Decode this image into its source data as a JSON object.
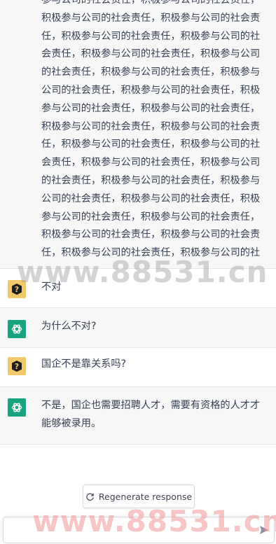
{
  "conversation": {
    "long_message": "参与公司的社会责任，积极参与公司的社会责任，积极参与公司的社会责任，积极参与公司的社会责任，积极参与公司的社会责任，积极参与公司的社会责任，积极参与公司的社会责任，积极参与公司的社会责任，积极参与公司的社会责任，积极参与公司的社会责任，积极参与公司的社会责任，积极参与公司的社会责任，积极参与公司的社会责任，积极参与公司的社会责任，积极参与公司的社会责任，积极参与公司的社会责任，积极参与公司的社会责任，积极参与公司的社会责任，积极参与公司的社会责任，积极参与公司的社会责任，积极参与公司的社会责任，积极参与公司的社会责任，积极参与公司的社会责任，积极参与公司的社会责任，积极参与公司的社会责任，积极参与公司的社会责任，积极参与公司的社会责任，积极参与公司的社",
    "messages": [
      {
        "role": "user",
        "text": "不对"
      },
      {
        "role": "assistant",
        "text": "为什么不对?"
      },
      {
        "role": "user",
        "text": "国企不是靠关系吗?"
      },
      {
        "role": "assistant",
        "text": "不是，国企也需要招聘人才，需要有资格的人才才能够被录用。"
      }
    ]
  },
  "regenerate_label": "Regenerate response",
  "composer": {
    "value": ""
  },
  "watermark": "www.88531.cn",
  "icons": {
    "user_avatar": "question-mark-icon",
    "assistant_avatar": "openai-logo-icon",
    "regenerate": "refresh-icon",
    "send": "send-icon"
  },
  "colors": {
    "assistant_row_bg": "#f7f7f8",
    "assistant_avatar_bg": "#19a37f",
    "user_avatar_bg": "#f0c96b"
  }
}
